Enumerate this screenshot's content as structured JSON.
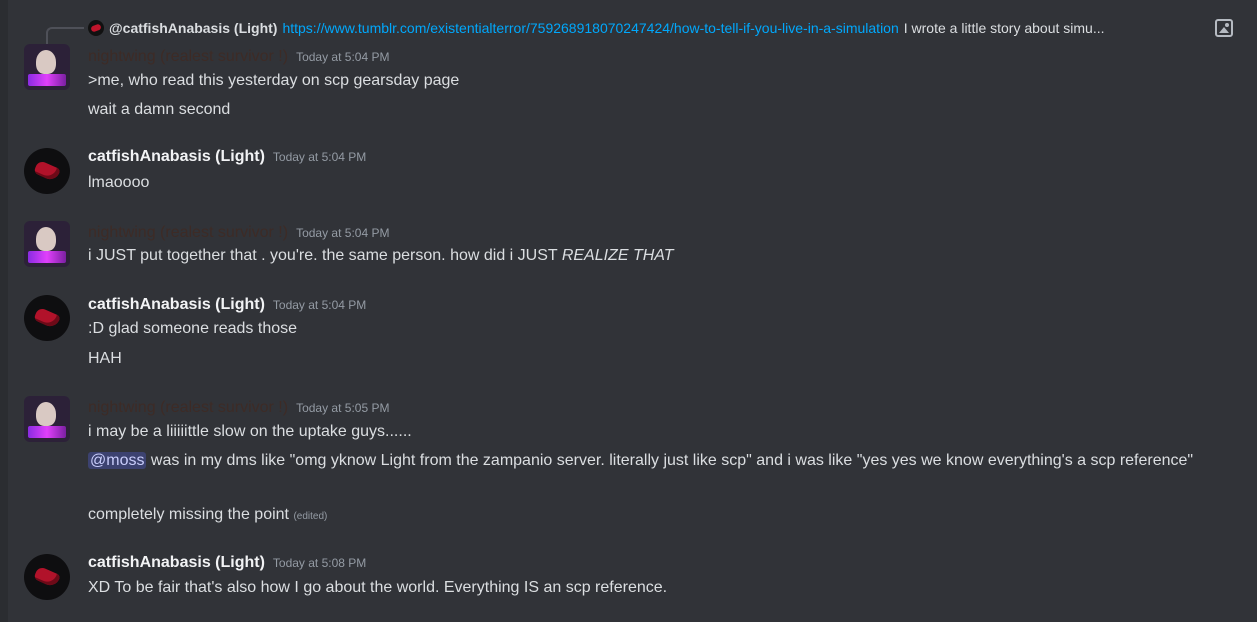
{
  "reply": {
    "author": "@catfishAnabasis (Light)",
    "link": "https://www.tumblr.com/existentialterror/759268918070247424/how-to-tell-if-you-live-in-a-simulation",
    "preview": "I wrote a little story about simu..."
  },
  "messages": [
    {
      "author": "nightwing (realest survivor !)",
      "time": "Today at 5:04 PM",
      "lines": [
        ">me, who read this yesterday on scp gearsday page",
        "wait a damn second"
      ]
    },
    {
      "author": "catfishAnabasis (Light)",
      "time": "Today at 5:04 PM",
      "lines": [
        "lmaoooo"
      ]
    },
    {
      "author": "nightwing (realest survivor !)",
      "time": "Today at 5:04 PM",
      "lines": [
        "i JUST put together that . you're. the same person. how did i JUST "
      ],
      "emphasis": "REALIZE THAT"
    },
    {
      "author": "catfishAnabasis (Light)",
      "time": "Today at 5:04 PM",
      "lines": [
        ":D glad someone reads those",
        "HAH"
      ]
    },
    {
      "author": "nightwing (realest survivor !)",
      "time": "Today at 5:05 PM",
      "lines": [
        "i may be a liiiiittle slow on the uptake guys......"
      ],
      "mention": "@moss",
      "mention_text": " was in my dms like \"omg yknow Light from the zampanio server. literally just like scp\" and i was like \"yes yes we know everything's a scp reference\"",
      "last_line": "completely missing the point",
      "edited": "(edited)"
    },
    {
      "author": "catfishAnabasis (Light)",
      "time": "Today at 5:08 PM",
      "lines": [
        "XD To be fair that's also how I go about the world. Everything IS an scp reference."
      ]
    }
  ],
  "colors": {
    "background": "#313338",
    "link": "#00a8fc",
    "mention_bg": "#3c4270"
  },
  "icons": [
    "image-icon",
    "catfish-avatar",
    "nightwing-avatar"
  ]
}
